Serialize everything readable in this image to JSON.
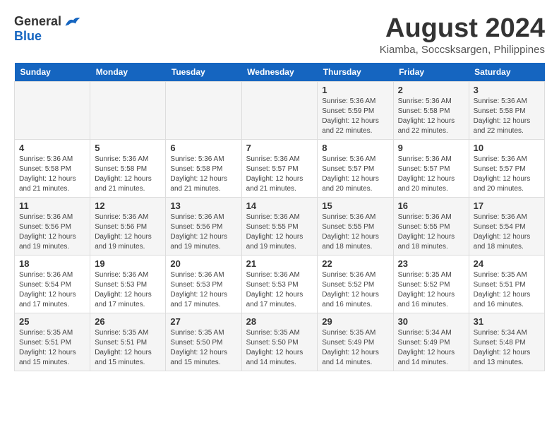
{
  "header": {
    "logo_general": "General",
    "logo_blue": "Blue",
    "month_title": "August 2024",
    "location": "Kiamba, Soccsksargen, Philippines"
  },
  "days_of_week": [
    "Sunday",
    "Monday",
    "Tuesday",
    "Wednesday",
    "Thursday",
    "Friday",
    "Saturday"
  ],
  "weeks": [
    [
      {
        "day": "",
        "info": ""
      },
      {
        "day": "",
        "info": ""
      },
      {
        "day": "",
        "info": ""
      },
      {
        "day": "",
        "info": ""
      },
      {
        "day": "1",
        "info": "Sunrise: 5:36 AM\nSunset: 5:59 PM\nDaylight: 12 hours\nand 22 minutes."
      },
      {
        "day": "2",
        "info": "Sunrise: 5:36 AM\nSunset: 5:58 PM\nDaylight: 12 hours\nand 22 minutes."
      },
      {
        "day": "3",
        "info": "Sunrise: 5:36 AM\nSunset: 5:58 PM\nDaylight: 12 hours\nand 22 minutes."
      }
    ],
    [
      {
        "day": "4",
        "info": "Sunrise: 5:36 AM\nSunset: 5:58 PM\nDaylight: 12 hours\nand 21 minutes."
      },
      {
        "day": "5",
        "info": "Sunrise: 5:36 AM\nSunset: 5:58 PM\nDaylight: 12 hours\nand 21 minutes."
      },
      {
        "day": "6",
        "info": "Sunrise: 5:36 AM\nSunset: 5:58 PM\nDaylight: 12 hours\nand 21 minutes."
      },
      {
        "day": "7",
        "info": "Sunrise: 5:36 AM\nSunset: 5:57 PM\nDaylight: 12 hours\nand 21 minutes."
      },
      {
        "day": "8",
        "info": "Sunrise: 5:36 AM\nSunset: 5:57 PM\nDaylight: 12 hours\nand 20 minutes."
      },
      {
        "day": "9",
        "info": "Sunrise: 5:36 AM\nSunset: 5:57 PM\nDaylight: 12 hours\nand 20 minutes."
      },
      {
        "day": "10",
        "info": "Sunrise: 5:36 AM\nSunset: 5:57 PM\nDaylight: 12 hours\nand 20 minutes."
      }
    ],
    [
      {
        "day": "11",
        "info": "Sunrise: 5:36 AM\nSunset: 5:56 PM\nDaylight: 12 hours\nand 19 minutes."
      },
      {
        "day": "12",
        "info": "Sunrise: 5:36 AM\nSunset: 5:56 PM\nDaylight: 12 hours\nand 19 minutes."
      },
      {
        "day": "13",
        "info": "Sunrise: 5:36 AM\nSunset: 5:56 PM\nDaylight: 12 hours\nand 19 minutes."
      },
      {
        "day": "14",
        "info": "Sunrise: 5:36 AM\nSunset: 5:55 PM\nDaylight: 12 hours\nand 19 minutes."
      },
      {
        "day": "15",
        "info": "Sunrise: 5:36 AM\nSunset: 5:55 PM\nDaylight: 12 hours\nand 18 minutes."
      },
      {
        "day": "16",
        "info": "Sunrise: 5:36 AM\nSunset: 5:55 PM\nDaylight: 12 hours\nand 18 minutes."
      },
      {
        "day": "17",
        "info": "Sunrise: 5:36 AM\nSunset: 5:54 PM\nDaylight: 12 hours\nand 18 minutes."
      }
    ],
    [
      {
        "day": "18",
        "info": "Sunrise: 5:36 AM\nSunset: 5:54 PM\nDaylight: 12 hours\nand 17 minutes."
      },
      {
        "day": "19",
        "info": "Sunrise: 5:36 AM\nSunset: 5:53 PM\nDaylight: 12 hours\nand 17 minutes."
      },
      {
        "day": "20",
        "info": "Sunrise: 5:36 AM\nSunset: 5:53 PM\nDaylight: 12 hours\nand 17 minutes."
      },
      {
        "day": "21",
        "info": "Sunrise: 5:36 AM\nSunset: 5:53 PM\nDaylight: 12 hours\nand 17 minutes."
      },
      {
        "day": "22",
        "info": "Sunrise: 5:36 AM\nSunset: 5:52 PM\nDaylight: 12 hours\nand 16 minutes."
      },
      {
        "day": "23",
        "info": "Sunrise: 5:35 AM\nSunset: 5:52 PM\nDaylight: 12 hours\nand 16 minutes."
      },
      {
        "day": "24",
        "info": "Sunrise: 5:35 AM\nSunset: 5:51 PM\nDaylight: 12 hours\nand 16 minutes."
      }
    ],
    [
      {
        "day": "25",
        "info": "Sunrise: 5:35 AM\nSunset: 5:51 PM\nDaylight: 12 hours\nand 15 minutes."
      },
      {
        "day": "26",
        "info": "Sunrise: 5:35 AM\nSunset: 5:51 PM\nDaylight: 12 hours\nand 15 minutes."
      },
      {
        "day": "27",
        "info": "Sunrise: 5:35 AM\nSunset: 5:50 PM\nDaylight: 12 hours\nand 15 minutes."
      },
      {
        "day": "28",
        "info": "Sunrise: 5:35 AM\nSunset: 5:50 PM\nDaylight: 12 hours\nand 14 minutes."
      },
      {
        "day": "29",
        "info": "Sunrise: 5:35 AM\nSunset: 5:49 PM\nDaylight: 12 hours\nand 14 minutes."
      },
      {
        "day": "30",
        "info": "Sunrise: 5:34 AM\nSunset: 5:49 PM\nDaylight: 12 hours\nand 14 minutes."
      },
      {
        "day": "31",
        "info": "Sunrise: 5:34 AM\nSunset: 5:48 PM\nDaylight: 12 hours\nand 13 minutes."
      }
    ]
  ]
}
